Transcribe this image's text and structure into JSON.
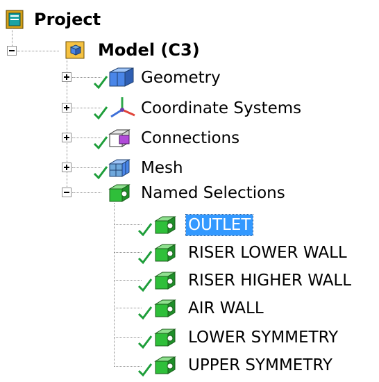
{
  "tree": {
    "root_label": "Project",
    "model_label": "Model (C3)",
    "model_children": [
      {
        "label": "Geometry",
        "icon": "geometry-icon"
      },
      {
        "label": "Coordinate Systems",
        "icon": "coordinate-systems-icon"
      },
      {
        "label": "Connections",
        "icon": "connections-icon"
      },
      {
        "label": "Mesh",
        "icon": "mesh-icon"
      },
      {
        "label": "Named Selections",
        "icon": "named-selections-icon"
      }
    ],
    "named_selections": [
      {
        "label": "OUTLET",
        "selected": true
      },
      {
        "label": "RISER LOWER WALL"
      },
      {
        "label": "RISER HIGHER WALL"
      },
      {
        "label": "AIR WALL"
      },
      {
        "label": "LOWER SYMMETRY"
      },
      {
        "label": "UPPER SYMMETRY"
      }
    ]
  },
  "colors": {
    "selection": "#3399ff",
    "check": "#1e9e3a",
    "box_green": "#2fbf3a",
    "box_blue": "#4a86e8"
  }
}
